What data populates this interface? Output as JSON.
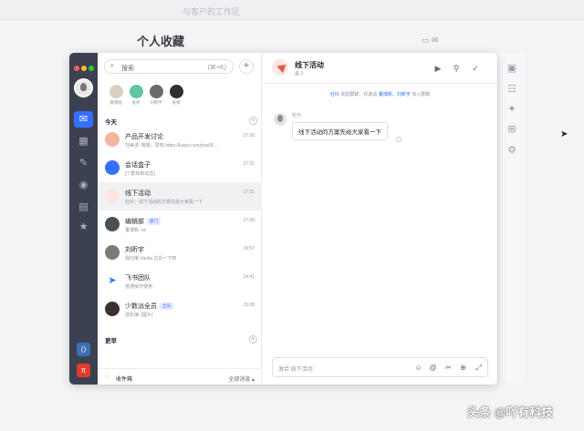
{
  "background": {
    "topbar_title": "与客户的工作区",
    "page_title": "个人收藏"
  },
  "search": {
    "placeholder": "搜索",
    "shortcut": "(⌘+K)"
  },
  "pins": [
    {
      "name": "黄晓晓",
      "color": "#d8d0c2"
    },
    {
      "name": "张伟",
      "color": "#5fc4a5"
    },
    {
      "name": "刘昕宇",
      "color": "#6a6a6a"
    },
    {
      "name": "姜博",
      "color": "#2f2f2f"
    }
  ],
  "sections": {
    "today": "今天",
    "more": "更早"
  },
  "chats": [
    {
      "name": "产品开发讨论",
      "preview": "刘美清: 嗯嗯，赞啦  https://kapsi.com/post/8...",
      "time": "17:30",
      "color": "#f3b49f",
      "tag": ""
    },
    {
      "name": "会话盒子",
      "preview": "[个群有新动态]",
      "time": "17:31",
      "color": "#3370ff",
      "tag": ""
    },
    {
      "name": "线下活动",
      "preview": "杜玲：线下活动的方案先给大家看一下",
      "time": "17:31",
      "color": "#fde7e3",
      "tag": ""
    },
    {
      "name": "编辑部",
      "preview": "董博帆: ok",
      "time": "17:28",
      "color": "#4a4f5a",
      "tag": "部门"
    },
    {
      "name": "刘昕宇",
      "preview": "我向接 Vanila 过论一下吧",
      "time": "16:57",
      "color": "#7a7a7a",
      "tag": ""
    },
    {
      "name": "飞书团队",
      "preview": "普通操作使用",
      "time": "14:41",
      "color": "#ffffff",
      "tag": ""
    },
    {
      "name": "少数派全员",
      "preview": "邵年梅: [图片]",
      "time": "15:08",
      "color": "#3b3030",
      "tag": "全员"
    }
  ],
  "footer": {
    "inbox": "收件箱",
    "all_messages": "全部消息 ▴"
  },
  "chat": {
    "title": "线下活动",
    "subtitle": "晶 3",
    "system_prefix": "杜玲",
    "system_mid": " 发起群聊，并邀请 ",
    "system_names": "董博帆、刘昕宇",
    "system_suffix": " 加入群聊",
    "sender": "杜玲",
    "message": "线下活动的方案先给大家看一下",
    "composer_placeholder": "发给 线下活动"
  },
  "watermark": "头条 @吖有科技",
  "colors": {
    "accent": "#3370ff",
    "rail": "#3c4152"
  }
}
